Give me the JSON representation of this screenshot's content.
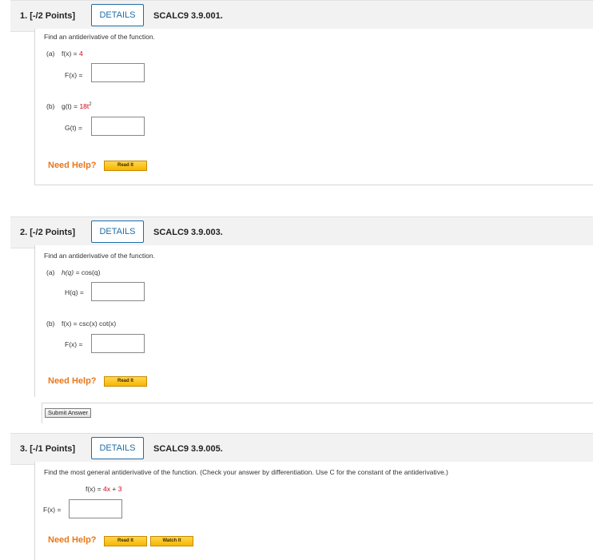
{
  "questions": [
    {
      "num": "1. [-/2 Points]",
      "details": "DETAILS",
      "code": "SCALC9 3.9.001.",
      "instruction": "Find an antiderivative of the function.",
      "parts": [
        {
          "label": "(a)",
          "func_lhs": "f(x) =",
          "func_rhs": "4",
          "answer_label": "F(x) ="
        },
        {
          "label": "(b)",
          "func_lhs": "g(t) =",
          "func_rhs_base": "18t",
          "func_rhs_exp": "2",
          "answer_label": "G(t) ="
        }
      ],
      "need_help": "Need Help?",
      "read_it": "Read It"
    },
    {
      "num": "2. [-/2 Points]",
      "details": "DETAILS",
      "code": "SCALC9 3.9.003.",
      "instruction": "Find an antiderivative of the function.",
      "parts": [
        {
          "label": "(a)",
          "func_lhs": "h(q) =",
          "func_rhs": "cos(q)",
          "answer_label": "H(q) ="
        },
        {
          "label": "(b)",
          "func_lhs": "f(x) =",
          "func_rhs": "csc(x) cot(x)",
          "answer_label": "F(x) ="
        }
      ],
      "need_help": "Need Help?",
      "read_it": "Read It",
      "submit": "Submit Answer"
    },
    {
      "num": "3. [-/1 Points]",
      "details": "DETAILS",
      "code": "SCALC9 3.9.005.",
      "instruction": "Find the most general antiderivative of the function. (Check your answer by differentiation. Use C for the constant of the antiderivative.)",
      "func_lhs": "f(x) =",
      "func_rhs_a": "4x",
      "func_plus": "+",
      "func_rhs_b": "3",
      "answer_label": "F(x) =",
      "need_help": "Need Help?",
      "read_it": "Read It",
      "watch_it": "Watch It"
    }
  ]
}
